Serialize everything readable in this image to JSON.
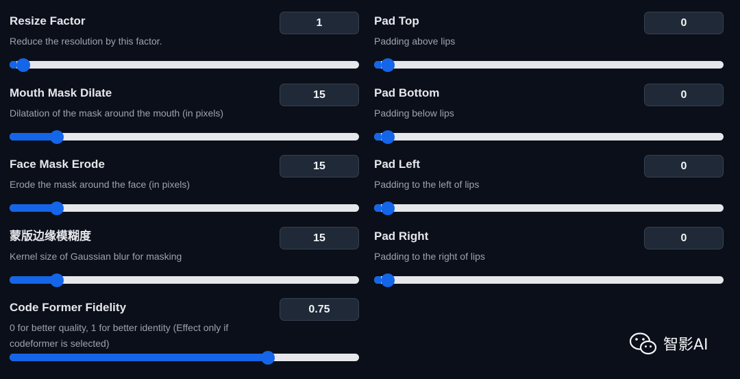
{
  "left_params": [
    {
      "title": "Resize Factor",
      "desc": "Reduce the resolution by this factor.",
      "value": "1",
      "fill": 0.02
    },
    {
      "title": "Mouth Mask Dilate",
      "desc": "Dilatation of the mask around the mouth (in pixels)",
      "value": "15",
      "fill": 0.135
    },
    {
      "title": "Face Mask Erode",
      "desc": "Erode the mask around the face (in pixels)",
      "value": "15",
      "fill": 0.135
    },
    {
      "title": "蒙版边缘模糊度",
      "desc": "Kernel size of Gaussian blur for masking",
      "value": "15",
      "fill": 0.135
    },
    {
      "title": "Code Former Fidelity",
      "desc": "0 for better quality, 1 for better identity (Effect only if codeformer is selected)",
      "value": "0.75",
      "fill": 0.74
    }
  ],
  "right_params": [
    {
      "title": "Pad Top",
      "desc": "Padding above lips",
      "value": "0",
      "fill": 0.02
    },
    {
      "title": "Pad Bottom",
      "desc": "Padding below lips",
      "value": "0",
      "fill": 0.02
    },
    {
      "title": "Pad Left",
      "desc": "Padding to the left of lips",
      "value": "0",
      "fill": 0.02
    },
    {
      "title": "Pad Right",
      "desc": "Padding to the right of lips",
      "value": "0",
      "fill": 0.02
    }
  ],
  "watermark": {
    "text": "智影AI",
    "icon": "wechat-icon"
  },
  "colors": {
    "background": "#0b0f19",
    "accent": "#1565e8",
    "track": "#e5e7eb",
    "input_bg": "#1f2937"
  }
}
